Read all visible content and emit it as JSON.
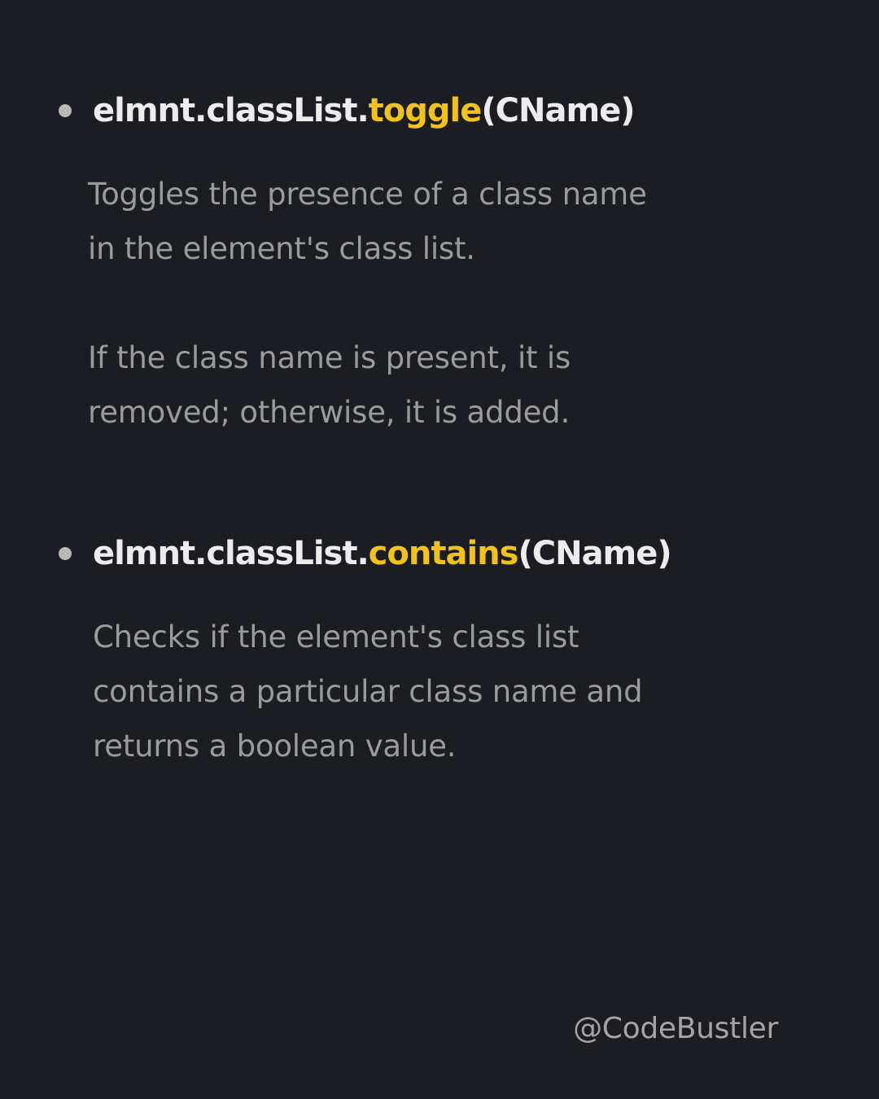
{
  "methods": [
    {
      "object": "elmnt.classList.",
      "method": "toggle",
      "args": "(CName)",
      "description_lines": [
        "Toggles the presence of a class name",
        "in the element's class list."
      ],
      "extra_lines": [
        "If the class name is present, it is",
        "removed; otherwise, it is added."
      ]
    },
    {
      "object": "elmnt.classList.",
      "method": "contains",
      "args": "(CName)",
      "description_lines": [
        "Checks if the element's class list",
        "contains a particular class name and",
        "returns a boolean value."
      ]
    }
  ],
  "footer": {
    "handle": "@CodeBustler"
  },
  "colors": {
    "background": "#1b1d23",
    "heading": "#ececec",
    "accent": "#f2c11a",
    "body_text": "#9a9b9d",
    "bullet": "#b8b8b8"
  }
}
